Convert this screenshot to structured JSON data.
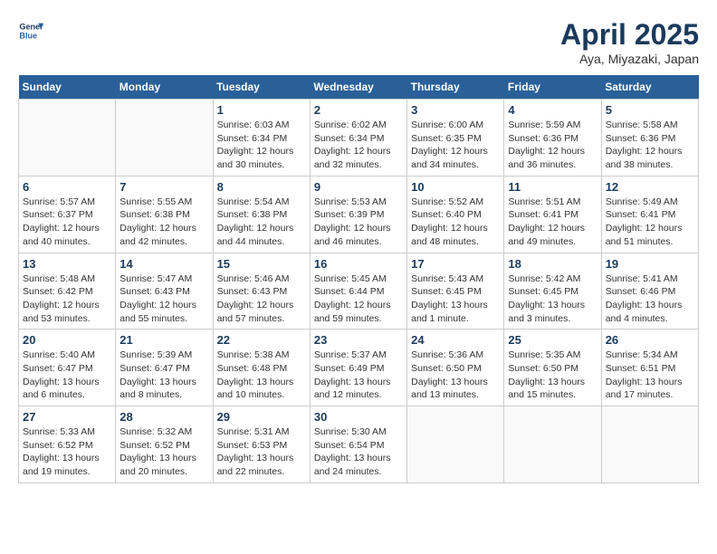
{
  "header": {
    "logo_line1": "General",
    "logo_line2": "Blue",
    "month_title": "April 2025",
    "location": "Aya, Miyazaki, Japan"
  },
  "weekdays": [
    "Sunday",
    "Monday",
    "Tuesday",
    "Wednesday",
    "Thursday",
    "Friday",
    "Saturday"
  ],
  "weeks": [
    [
      {
        "day": "",
        "info": ""
      },
      {
        "day": "",
        "info": ""
      },
      {
        "day": "1",
        "info": "Sunrise: 6:03 AM\nSunset: 6:34 PM\nDaylight: 12 hours and 30 minutes."
      },
      {
        "day": "2",
        "info": "Sunrise: 6:02 AM\nSunset: 6:34 PM\nDaylight: 12 hours and 32 minutes."
      },
      {
        "day": "3",
        "info": "Sunrise: 6:00 AM\nSunset: 6:35 PM\nDaylight: 12 hours and 34 minutes."
      },
      {
        "day": "4",
        "info": "Sunrise: 5:59 AM\nSunset: 6:36 PM\nDaylight: 12 hours and 36 minutes."
      },
      {
        "day": "5",
        "info": "Sunrise: 5:58 AM\nSunset: 6:36 PM\nDaylight: 12 hours and 38 minutes."
      }
    ],
    [
      {
        "day": "6",
        "info": "Sunrise: 5:57 AM\nSunset: 6:37 PM\nDaylight: 12 hours and 40 minutes."
      },
      {
        "day": "7",
        "info": "Sunrise: 5:55 AM\nSunset: 6:38 PM\nDaylight: 12 hours and 42 minutes."
      },
      {
        "day": "8",
        "info": "Sunrise: 5:54 AM\nSunset: 6:38 PM\nDaylight: 12 hours and 44 minutes."
      },
      {
        "day": "9",
        "info": "Sunrise: 5:53 AM\nSunset: 6:39 PM\nDaylight: 12 hours and 46 minutes."
      },
      {
        "day": "10",
        "info": "Sunrise: 5:52 AM\nSunset: 6:40 PM\nDaylight: 12 hours and 48 minutes."
      },
      {
        "day": "11",
        "info": "Sunrise: 5:51 AM\nSunset: 6:41 PM\nDaylight: 12 hours and 49 minutes."
      },
      {
        "day": "12",
        "info": "Sunrise: 5:49 AM\nSunset: 6:41 PM\nDaylight: 12 hours and 51 minutes."
      }
    ],
    [
      {
        "day": "13",
        "info": "Sunrise: 5:48 AM\nSunset: 6:42 PM\nDaylight: 12 hours and 53 minutes."
      },
      {
        "day": "14",
        "info": "Sunrise: 5:47 AM\nSunset: 6:43 PM\nDaylight: 12 hours and 55 minutes."
      },
      {
        "day": "15",
        "info": "Sunrise: 5:46 AM\nSunset: 6:43 PM\nDaylight: 12 hours and 57 minutes."
      },
      {
        "day": "16",
        "info": "Sunrise: 5:45 AM\nSunset: 6:44 PM\nDaylight: 12 hours and 59 minutes."
      },
      {
        "day": "17",
        "info": "Sunrise: 5:43 AM\nSunset: 6:45 PM\nDaylight: 13 hours and 1 minute."
      },
      {
        "day": "18",
        "info": "Sunrise: 5:42 AM\nSunset: 6:45 PM\nDaylight: 13 hours and 3 minutes."
      },
      {
        "day": "19",
        "info": "Sunrise: 5:41 AM\nSunset: 6:46 PM\nDaylight: 13 hours and 4 minutes."
      }
    ],
    [
      {
        "day": "20",
        "info": "Sunrise: 5:40 AM\nSunset: 6:47 PM\nDaylight: 13 hours and 6 minutes."
      },
      {
        "day": "21",
        "info": "Sunrise: 5:39 AM\nSunset: 6:47 PM\nDaylight: 13 hours and 8 minutes."
      },
      {
        "day": "22",
        "info": "Sunrise: 5:38 AM\nSunset: 6:48 PM\nDaylight: 13 hours and 10 minutes."
      },
      {
        "day": "23",
        "info": "Sunrise: 5:37 AM\nSunset: 6:49 PM\nDaylight: 13 hours and 12 minutes."
      },
      {
        "day": "24",
        "info": "Sunrise: 5:36 AM\nSunset: 6:50 PM\nDaylight: 13 hours and 13 minutes."
      },
      {
        "day": "25",
        "info": "Sunrise: 5:35 AM\nSunset: 6:50 PM\nDaylight: 13 hours and 15 minutes."
      },
      {
        "day": "26",
        "info": "Sunrise: 5:34 AM\nSunset: 6:51 PM\nDaylight: 13 hours and 17 minutes."
      }
    ],
    [
      {
        "day": "27",
        "info": "Sunrise: 5:33 AM\nSunset: 6:52 PM\nDaylight: 13 hours and 19 minutes."
      },
      {
        "day": "28",
        "info": "Sunrise: 5:32 AM\nSunset: 6:52 PM\nDaylight: 13 hours and 20 minutes."
      },
      {
        "day": "29",
        "info": "Sunrise: 5:31 AM\nSunset: 6:53 PM\nDaylight: 13 hours and 22 minutes."
      },
      {
        "day": "30",
        "info": "Sunrise: 5:30 AM\nSunset: 6:54 PM\nDaylight: 13 hours and 24 minutes."
      },
      {
        "day": "",
        "info": ""
      },
      {
        "day": "",
        "info": ""
      },
      {
        "day": "",
        "info": ""
      }
    ]
  ]
}
